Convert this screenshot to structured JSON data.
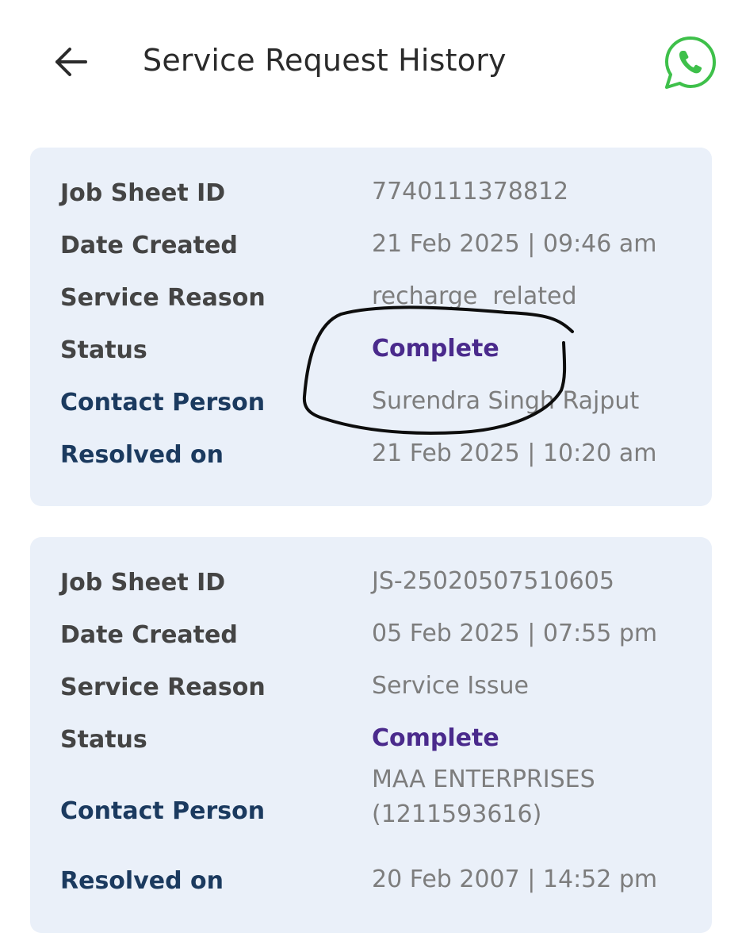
{
  "header": {
    "title": "Service Request History",
    "back_icon": "arrow-left-icon",
    "whatsapp_icon": "whatsapp-icon",
    "whatsapp_color": "#3ec04a"
  },
  "colors": {
    "card_background": "#eaf0f9",
    "label_gray": "#444444",
    "label_blue": "#1b3a5f",
    "value_gray": "#7d7d7d",
    "status_purple": "#4a2a8c"
  },
  "requests": [
    {
      "job_sheet_id_label": "Job Sheet ID",
      "job_sheet_id": "7740111378812",
      "date_created_label": "Date Created",
      "date_created": "21 Feb 2025 | 09:46 am",
      "service_reason_label": "Service Reason",
      "service_reason": "recharge  related",
      "status_label": "Status",
      "status": "Complete",
      "contact_person_label": "Contact Person",
      "contact_person": "Surendra Singh Rajput",
      "resolved_on_label": "Resolved on",
      "resolved_on": "21 Feb 2025 | 10:20 am"
    },
    {
      "job_sheet_id_label": "Job Sheet ID",
      "job_sheet_id": "JS-25020507510605",
      "date_created_label": "Date Created",
      "date_created": "05 Feb 2025 | 07:55 pm",
      "service_reason_label": "Service Reason",
      "service_reason": "Service Issue",
      "status_label": "Status",
      "status": "Complete",
      "contact_person_label": "Contact Person",
      "contact_person": "MAA ENTERPRISES (1211593616)",
      "resolved_on_label": "Resolved on",
      "resolved_on": "20 Feb 2007 | 14:52 pm"
    }
  ]
}
